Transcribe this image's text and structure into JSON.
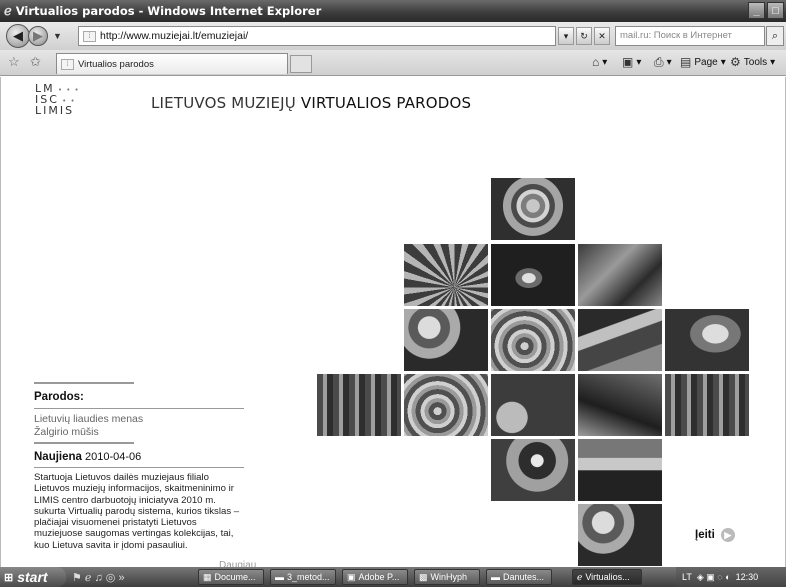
{
  "window": {
    "title": "Virtualios parodos - Windows Internet Explorer",
    "controls": [
      "minimize",
      "maximize"
    ]
  },
  "address_bar": {
    "url": "http://www.muziejai.lt/emuziejai/",
    "search_placeholder": "mail.ru: Поиск в Интернет"
  },
  "tabs": [
    {
      "label": "Virtualios parodos"
    }
  ],
  "command_bar": {
    "page_label": "Page",
    "tools_label": "Tools"
  },
  "site": {
    "logo_lines": [
      "LM",
      "ISC",
      "LIMIS"
    ],
    "heading_light": "LIETUVOS MUZIEJŲ",
    "heading_bold": "VIRTUALIOS PARODOS",
    "exhibitions_title": "Parodos:",
    "exhibitions": [
      "Lietuvių liaudies menas",
      "Žalgirio mūšis"
    ],
    "news_title": "Naujiena",
    "news_date": "2010-04-06",
    "news_text": "Startuoja Lietuvos dailės muziejaus filialo Lietuvos muziejų informacijos, skaitmeninimo ir LIMIS centro darbuotojų iniciatyva 2010 m. sukurta Virtualių parodų sistema, kurios tikslas – plačiajai visuomenei pristatyti Lietuvos muziejuose saugomas vertingas kolekcijas, tai, kuo Lietuva savita ir įdomi pasauliui.",
    "more_label": "Daugiau",
    "enter_label": "Įeiti"
  },
  "taskbar": {
    "start_label": "start",
    "tasks": [
      {
        "label": "Docume..."
      },
      {
        "label": "3_metod..."
      },
      {
        "label": "Adobe P..."
      },
      {
        "label": "WinHyph"
      },
      {
        "label": "Danutes..."
      },
      {
        "label": "Virtualios..."
      }
    ],
    "language": "LT",
    "clock": "12:30"
  }
}
